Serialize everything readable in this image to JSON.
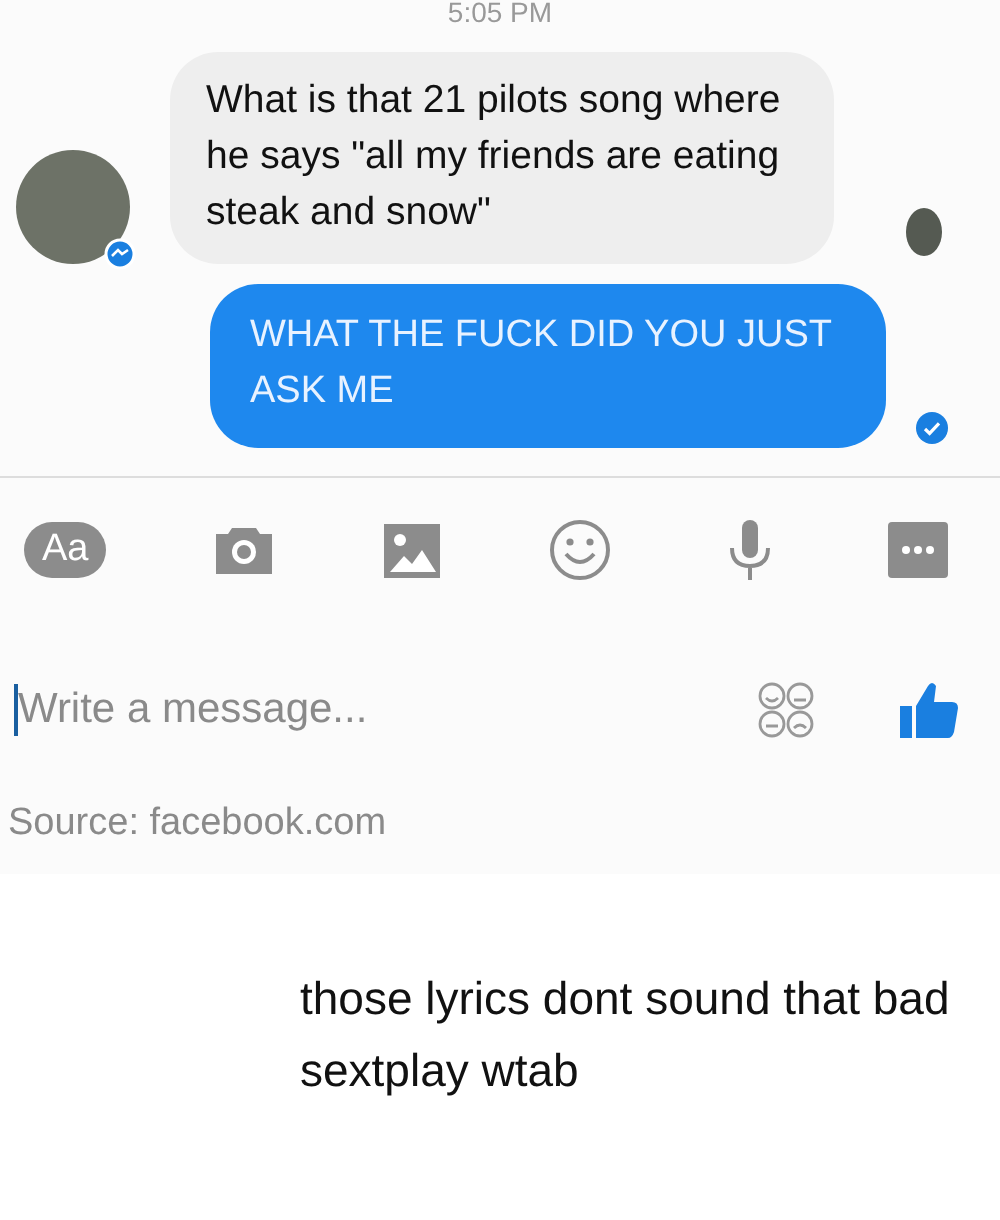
{
  "status": {
    "time": "5:05 PM"
  },
  "messages": [
    {
      "kind": "incoming",
      "text": "What is that 21 pilots song where he says \"all my friends are eating steak and snow\""
    },
    {
      "kind": "outgoing",
      "text": "WHAT THE FUCK DID YOU JUST ASK ME"
    }
  ],
  "toolbar": {
    "text_button": "Aa"
  },
  "composer": {
    "placeholder": "Write a message..."
  },
  "source": "Source: facebook.com",
  "caption": "those lyrics dont sound that bad sextplay wtab"
}
